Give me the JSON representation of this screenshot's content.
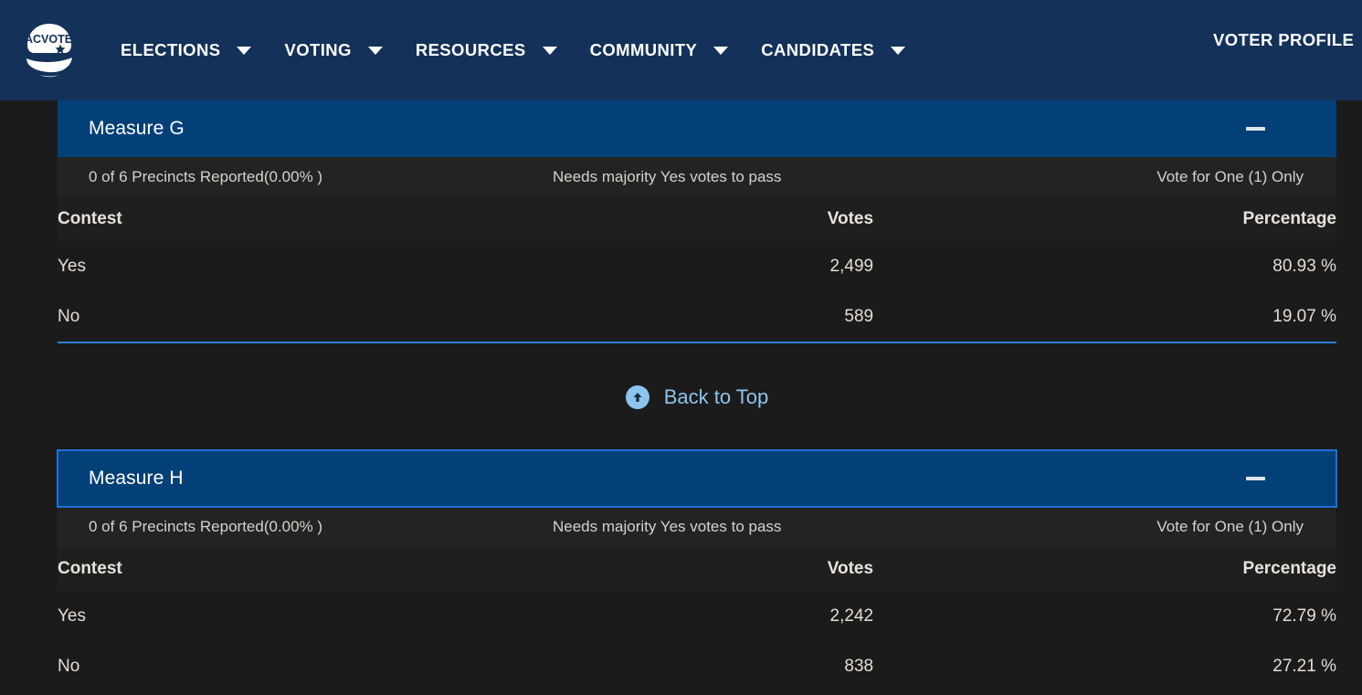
{
  "navbar": {
    "logo_text": "ACVOTE",
    "logo_name": "acvote-logo",
    "items": [
      {
        "label": "ELECTIONS",
        "icon": "chevron-down-icon"
      },
      {
        "label": "VOTING",
        "icon": "chevron-down-icon"
      },
      {
        "label": "RESOURCES",
        "icon": "chevron-down-icon"
      },
      {
        "label": "COMMUNITY",
        "icon": "chevron-down-icon"
      },
      {
        "label": "CANDIDATES",
        "icon": "chevron-down-icon"
      }
    ],
    "right_link": "VOTER PROFILE"
  },
  "back_to_top": {
    "label": "Back to Top",
    "icon": "arrow-up-circle-icon"
  },
  "columns": {
    "contest": "Contest",
    "votes": "Votes",
    "percentage": "Percentage"
  },
  "contests": [
    {
      "title": "Measure G",
      "collapse_icon": "minus-icon",
      "precincts": "0 of 6 Precincts Reported(0.00% )",
      "rule": "Needs majority Yes votes to pass",
      "vote_info": "Vote for One (1) Only",
      "rows": [
        {
          "contest": "Yes",
          "votes": "2,499",
          "percentage": "80.93 %"
        },
        {
          "contest": "No",
          "votes": "589",
          "percentage": "19.07 %"
        }
      ]
    },
    {
      "title": "Measure H",
      "collapse_icon": "minus-icon",
      "precincts": "0 of 6 Precincts Reported(0.00% )",
      "rule": "Needs majority Yes votes to pass",
      "vote_info": "Vote for One (1) Only",
      "rows": [
        {
          "contest": "Yes",
          "votes": "2,242",
          "percentage": "72.79 %"
        },
        {
          "contest": "No",
          "votes": "838",
          "percentage": "27.21 %"
        }
      ]
    }
  ],
  "colors": {
    "navbar_bg": "#133159",
    "contest_header_bg": "#044078",
    "page_bg": "#1b1b1b",
    "meta_row_bg": "#232323",
    "accent_blue": "#2f7fd6",
    "link_blue": "#8cc4ee",
    "focus_outline": "#1f6fdb"
  }
}
